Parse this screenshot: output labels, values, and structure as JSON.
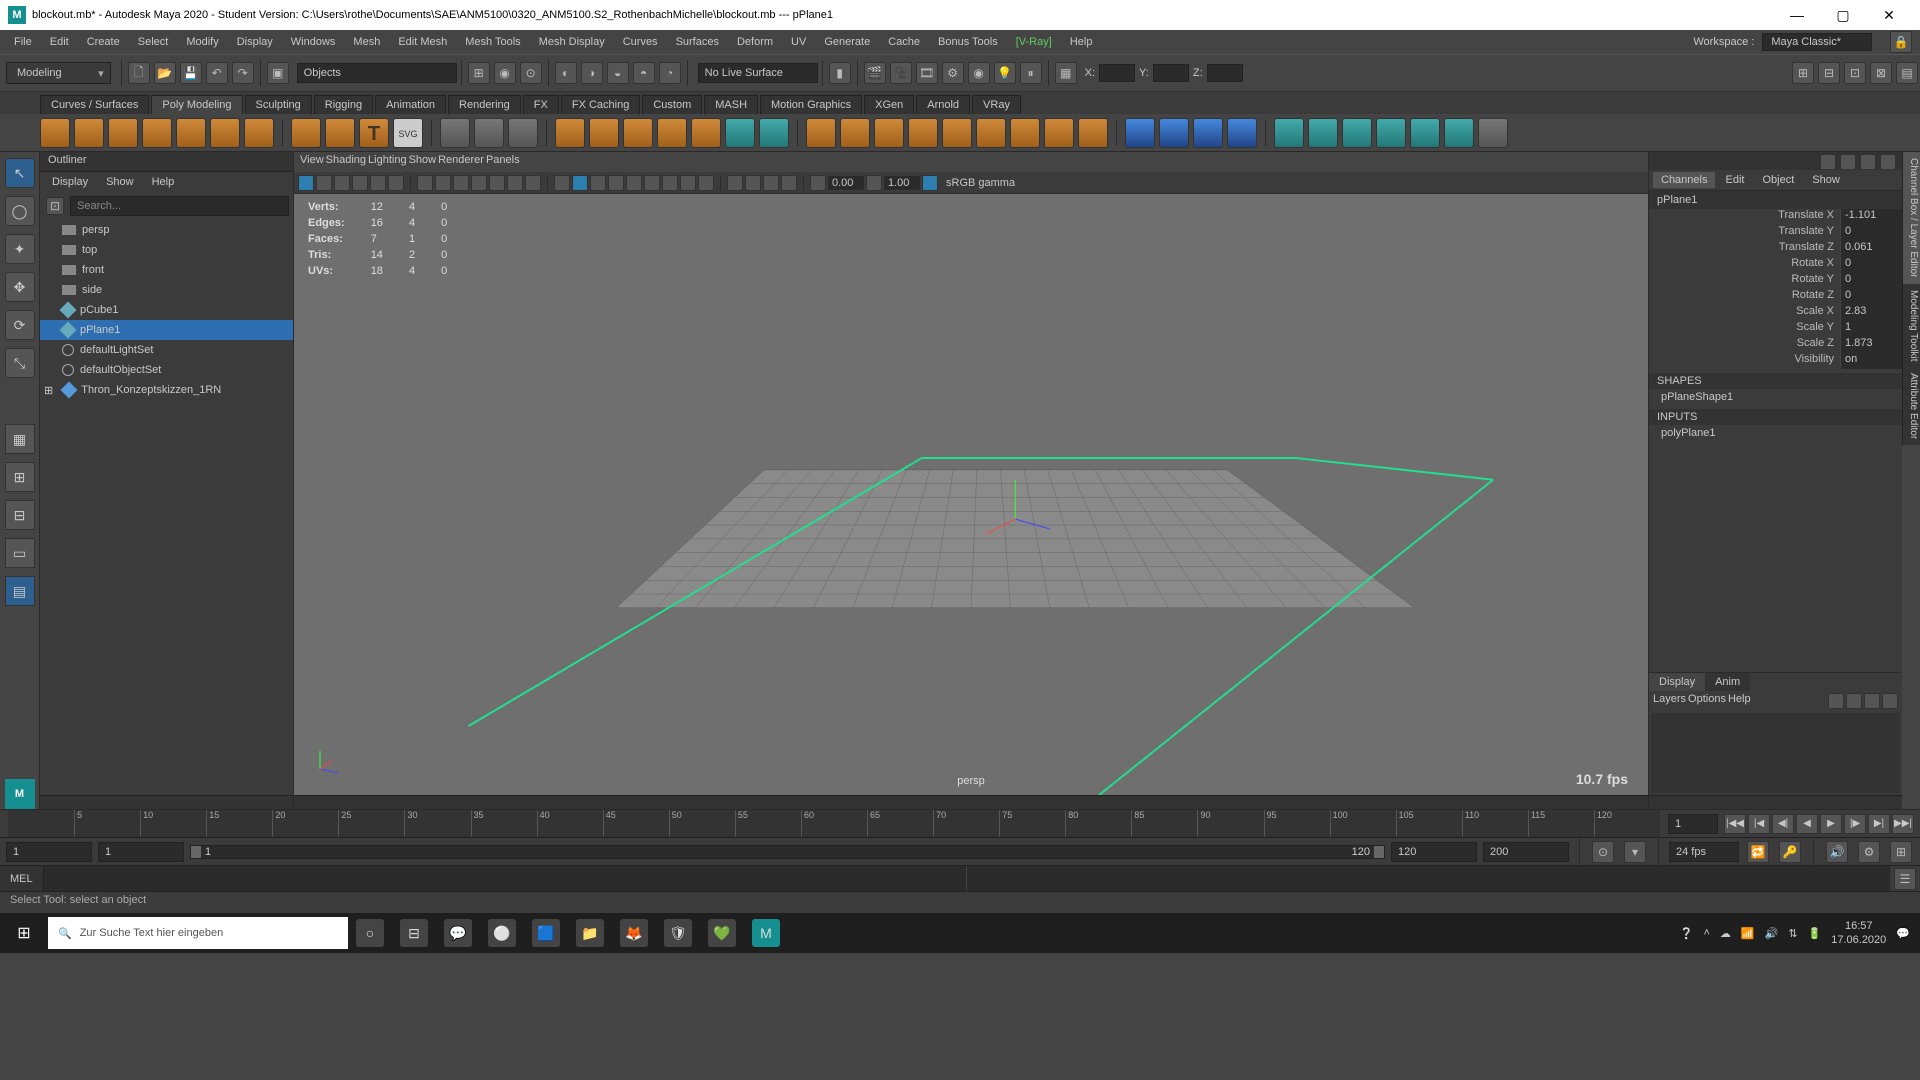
{
  "title": "blockout.mb* - Autodesk Maya 2020 - Student Version: C:\\Users\\rothe\\Documents\\SAE\\ANM5100\\0320_ANM5100.S2_RothenbachMichelle\\blockout.mb  ---  pPlane1",
  "menu": [
    "File",
    "Edit",
    "Create",
    "Select",
    "Modify",
    "Display",
    "Windows",
    "Mesh",
    "Edit Mesh",
    "Mesh Tools",
    "Mesh Display",
    "Curves",
    "Surfaces",
    "Deform",
    "UV",
    "Generate",
    "Cache",
    "Bonus Tools"
  ],
  "vray": "[V-Ray]",
  "help": "Help",
  "workspace_label": "Workspace :",
  "workspace_value": "Maya Classic*",
  "mode": "Modeling",
  "objects_label": "Objects",
  "nolive": "No Live Surface",
  "coord_labels": [
    "X:",
    "Y:",
    "Z:"
  ],
  "shelf_tabs": [
    "Curves / Surfaces",
    "Poly Modeling",
    "Sculpting",
    "Rigging",
    "Animation",
    "Rendering",
    "FX",
    "FX Caching",
    "Custom",
    "MASH",
    "Motion Graphics",
    "XGen",
    "Arnold",
    "VRay"
  ],
  "shelf_active": 1,
  "outliner": {
    "title": "Outliner",
    "menu": [
      "Display",
      "Show",
      "Help"
    ],
    "search_placeholder": "Search...",
    "items": [
      {
        "type": "cam",
        "label": "persp"
      },
      {
        "type": "cam",
        "label": "top"
      },
      {
        "type": "cam",
        "label": "front"
      },
      {
        "type": "cam",
        "label": "side"
      },
      {
        "type": "mesh",
        "label": "pCube1"
      },
      {
        "type": "mesh",
        "label": "pPlane1",
        "sel": true
      },
      {
        "type": "set",
        "label": "defaultLightSet"
      },
      {
        "type": "set",
        "label": "defaultObjectSet"
      },
      {
        "type": "scene",
        "label": "Thron_Konzeptskizzen_1RN"
      }
    ]
  },
  "viewport": {
    "menu": [
      "View",
      "Shading",
      "Lighting",
      "Show",
      "Renderer",
      "Panels"
    ],
    "exposure": "0.00",
    "gamma": "1.00",
    "colorspace": "sRGB gamma",
    "hud": [
      [
        "Verts:",
        "12",
        "4",
        "0"
      ],
      [
        "Edges:",
        "16",
        "4",
        "0"
      ],
      [
        "Faces:",
        "7",
        "1",
        "0"
      ],
      [
        "Tris:",
        "14",
        "2",
        "0"
      ],
      [
        "UVs:",
        "18",
        "4",
        "0"
      ]
    ],
    "camera": "persp",
    "fps": "10.7 fps"
  },
  "channel": {
    "menu": [
      "Channels",
      "Edit",
      "Object",
      "Show"
    ],
    "object": "pPlane1",
    "attrs": [
      [
        "Translate X",
        "-1.101"
      ],
      [
        "Translate Y",
        "0"
      ],
      [
        "Translate Z",
        "0.061"
      ],
      [
        "Rotate X",
        "0"
      ],
      [
        "Rotate Y",
        "0"
      ],
      [
        "Rotate Z",
        "0"
      ],
      [
        "Scale X",
        "2.83"
      ],
      [
        "Scale Y",
        "1"
      ],
      [
        "Scale Z",
        "1.873"
      ],
      [
        "Visibility",
        "on"
      ]
    ],
    "shapes_hdr": "SHAPES",
    "shape": "pPlaneShape1",
    "inputs_hdr": "INPUTS",
    "input": "polyPlane1",
    "disp_tabs": [
      "Display",
      "Anim"
    ],
    "disp_menu": [
      "Layers",
      "Options",
      "Help"
    ],
    "side_tabs": [
      "Channel Box / Layer Editor",
      "Modeling Toolkit",
      "Attribute Editor"
    ]
  },
  "timeline": {
    "ticks": [
      "5",
      "10",
      "15",
      "20",
      "25",
      "30",
      "35",
      "40",
      "45",
      "50",
      "55",
      "60",
      "65",
      "70",
      "75",
      "80",
      "85",
      "90",
      "95",
      "100",
      "105",
      "110",
      "115",
      "120"
    ],
    "cur": "1",
    "range": {
      "a": "1",
      "b": "1",
      "c": "1",
      "d": "120",
      "e": "120",
      "f": "200"
    },
    "fps": "24 fps"
  },
  "cmd_label": "MEL",
  "helpline": "Select Tool: select an object",
  "taskbar": {
    "search": "Zur Suche Text hier eingeben",
    "time": "16:57",
    "date": "17.06.2020"
  }
}
